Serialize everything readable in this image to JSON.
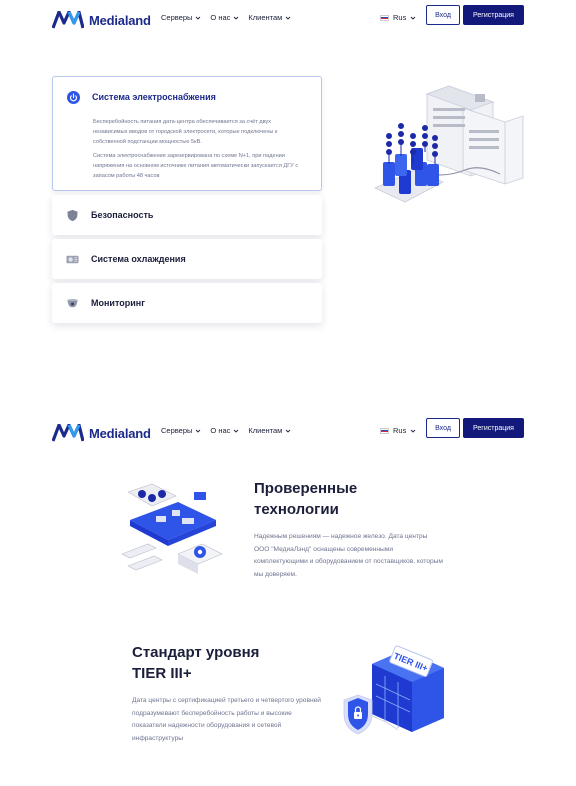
{
  "header": {
    "brand": "Medialand",
    "nav": [
      "Серверы",
      "О нас",
      "Клиентам"
    ],
    "lang": "Rus",
    "login": "Вход",
    "register": "Регистрация"
  },
  "infra": {
    "active": {
      "title": "Система электроснабжения",
      "p1": "Бесперебойность питания дата-центра обеспечивается за счёт двух независимых вводов от городской электросети, которые подключены к собственной подстанции мощностью 5кВ.",
      "p2": "Система электроснабжения зарезервирована по схеме N+1, при падении напряжения на основном источнике питания автоматически запускается ДГУ с запасом работы 48 часов"
    },
    "items": [
      "Безопасность",
      "Система охлаждения",
      "Мониторинг"
    ]
  },
  "features": {
    "tech": {
      "title": "Проверенные технологии",
      "text": "Надежным решениям — надежное железо. Дата центры ООО \"МедиаЛэнд\" оснащены современными комплектующими и оборудованием от поставщиков, которым мы доверяем."
    },
    "tier": {
      "title": "Стандарт уровня TIER III+",
      "text": "Дата центры с сертификацией третьего и четвертого уровней подразумевают бесперебойность работы и высокие показатели надежности оборудования и сетевой инфраструктуры",
      "badge": "TIER III+"
    }
  },
  "colors": {
    "brand": "#1c2a8c",
    "accent": "#2f55e8",
    "button": "#12197a"
  }
}
